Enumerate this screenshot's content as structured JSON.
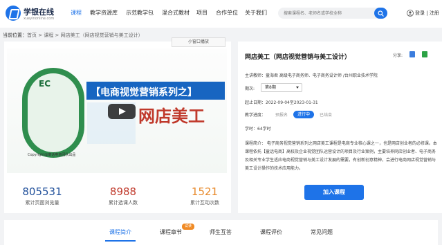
{
  "header": {
    "logo_title": "学银在线",
    "logo_sub": "xueyinonline.com",
    "nav": [
      "课程",
      "教学资源库",
      "示范教学包",
      "混合式教材",
      "项目",
      "合作单位",
      "关于我们"
    ],
    "search_placeholder": "搜索课程名、老师名或学校全称",
    "login": "登录 | 注册"
  },
  "breadcrumb": {
    "label": "当前位置：",
    "path": "首页 > 课程 > 网店美工（网店视觉营销与美工设计）"
  },
  "video": {
    "mini_window": "小窗口播放",
    "ec": "EC",
    "banner": "【电商视觉营销系列之】",
    "big_text": "网店美工",
    "copyright": "Copyright@童话电商团队出品"
  },
  "stats": [
    {
      "num": "805531",
      "label": "累计页面浏览量",
      "color": "#1f4f9a"
    },
    {
      "num": "8988",
      "label": "累计选课人数",
      "color": "#c0392b"
    },
    {
      "num": "1521",
      "label": "累计互动次数",
      "color": "#e8892a"
    }
  ],
  "course": {
    "title": "网店美工（网店视觉营销与美工设计）",
    "share_label": "分享:",
    "teacher": "主讲教师：童海君 高级电子商务师、电子商务设计师 /台州职业技术学院",
    "term_label": "期次:",
    "term_value": "第8期",
    "dates": "起止日期：2022-09-04至2023-01-31",
    "progress_label": "教学进度：",
    "progress_states": [
      "预报名",
      "进行中",
      "已结束"
    ],
    "hours": "学时：64学时",
    "intro": "课程简介： 电子商务视觉营销系列之网店美工课程是电商专业核心课之一，也是网店创业者的必修课。本课程依托【童话电商】高校及企业视觉团队运营设计的项目及行业案例，主要培养网店创业者、电子商务及相关专业学生适应电商视觉营销与美工设计发展的需要，有创新创意精神，会进行电商网店视觉营销与美工设计操作的技术应用能力。",
    "join": "加入课程"
  },
  "tabs": {
    "items": [
      "课程简介",
      "课程章节",
      "师生互答",
      "课程评价",
      "常见问题"
    ],
    "badge": "试读"
  },
  "colors": {
    "accent": "#1e73e8"
  }
}
